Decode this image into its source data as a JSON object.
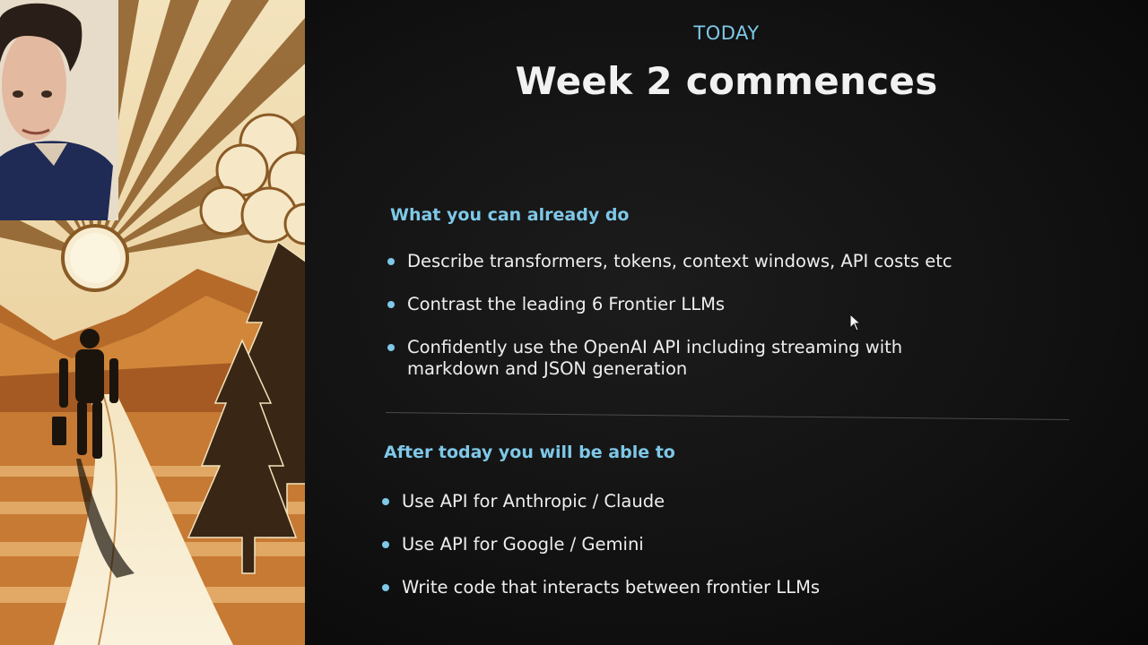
{
  "slide": {
    "eyebrow": "TODAY",
    "title": "Week 2 commences",
    "section_already": {
      "heading": "What you can already do",
      "items": [
        "Describe transformers, tokens, context windows, API costs etc",
        "Contrast the leading 6 Frontier LLMs",
        "Confidently use the OpenAI API including streaming with markdown and JSON generation"
      ]
    },
    "section_after": {
      "heading": "After today you will be able to",
      "items": [
        "Use API for Anthropic / Claude",
        "Use API for Google / Gemini",
        "Write code that interacts between frontier LLMs"
      ]
    },
    "colors": {
      "accent": "#7ec8e8",
      "background": "#0c0c0c",
      "text": "#eeeeee"
    }
  },
  "artwork": {
    "icons": [
      "sun-icon",
      "mountain-icon",
      "pine-tree-icon",
      "cloud-icon",
      "hiker-figure",
      "presenter-webcam"
    ]
  }
}
